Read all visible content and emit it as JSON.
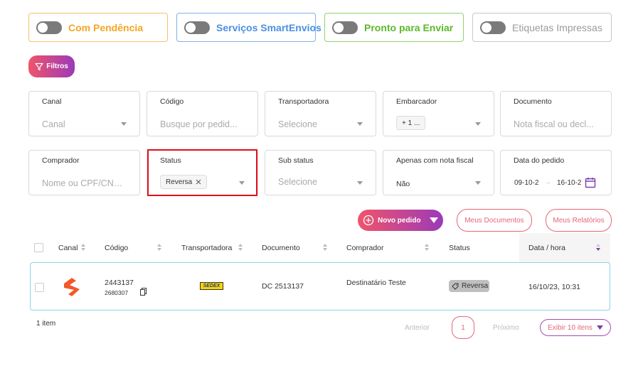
{
  "toggles": [
    {
      "label": "Com Pendência",
      "color": "#f5a623"
    },
    {
      "label": "Serviços SmartEnvios",
      "color": "#4a90e2"
    },
    {
      "label": "Pronto para Enviar",
      "color": "#7ed321"
    },
    {
      "label": "Etiquetas Impressas",
      "color": "#9b9b9b"
    }
  ],
  "filtros_label": "Filtros",
  "filters": {
    "canal": {
      "label": "Canal",
      "value": "Canal"
    },
    "codigo": {
      "label": "Código",
      "placeholder": "Busque por pedid..."
    },
    "transportadora": {
      "label": "Transportadora",
      "value": "Selecione"
    },
    "embarcador": {
      "label": "Embarcador",
      "tag": "+ 1 ..."
    },
    "documento": {
      "label": "Documento",
      "placeholder": "Nota fiscal ou decl..."
    },
    "comprador": {
      "label": "Comprador",
      "placeholder": "Nome ou CPF/CNPJ"
    },
    "status": {
      "label": "Status",
      "tag": "Reversa"
    },
    "sub_status": {
      "label": "Sub status",
      "value": "Selecione"
    },
    "nota_fiscal": {
      "label": "Apenas com nota fiscal",
      "value": "Não"
    },
    "data_pedido": {
      "label": "Data do pedido",
      "start": "09-10-2",
      "end": "16-10-2"
    }
  },
  "actions": {
    "novo_pedido": "Novo pedido",
    "meus_documentos": "Meus Documentos",
    "meus_relatorios": "Meus Relatórios"
  },
  "table": {
    "headers": {
      "canal": "Canal",
      "codigo": "Código",
      "transportadora": "Transportadora",
      "documento": "Documento",
      "comprador": "Comprador",
      "status": "Status",
      "data_hora": "Data / hora"
    },
    "rows": [
      {
        "codigo": "2443137",
        "codigo_sub": "2680307",
        "transportadora_logo": "SEDEX",
        "documento": "DC 2513137",
        "comprador": "Destinatário Teste",
        "status": "Reversa",
        "data_hora": "16/10/23, 10:31"
      }
    ]
  },
  "footer": {
    "count": "1 item",
    "anterior": "Anterior",
    "page": "1",
    "proximo": "Próximo",
    "exibir": "Exibir 10 itens"
  },
  "colors": {
    "accent_gradient_start": "#f0546a",
    "accent_gradient_end": "#9b3ab8",
    "highlight": "#e1101a",
    "brand_orange": "#f05a28"
  }
}
